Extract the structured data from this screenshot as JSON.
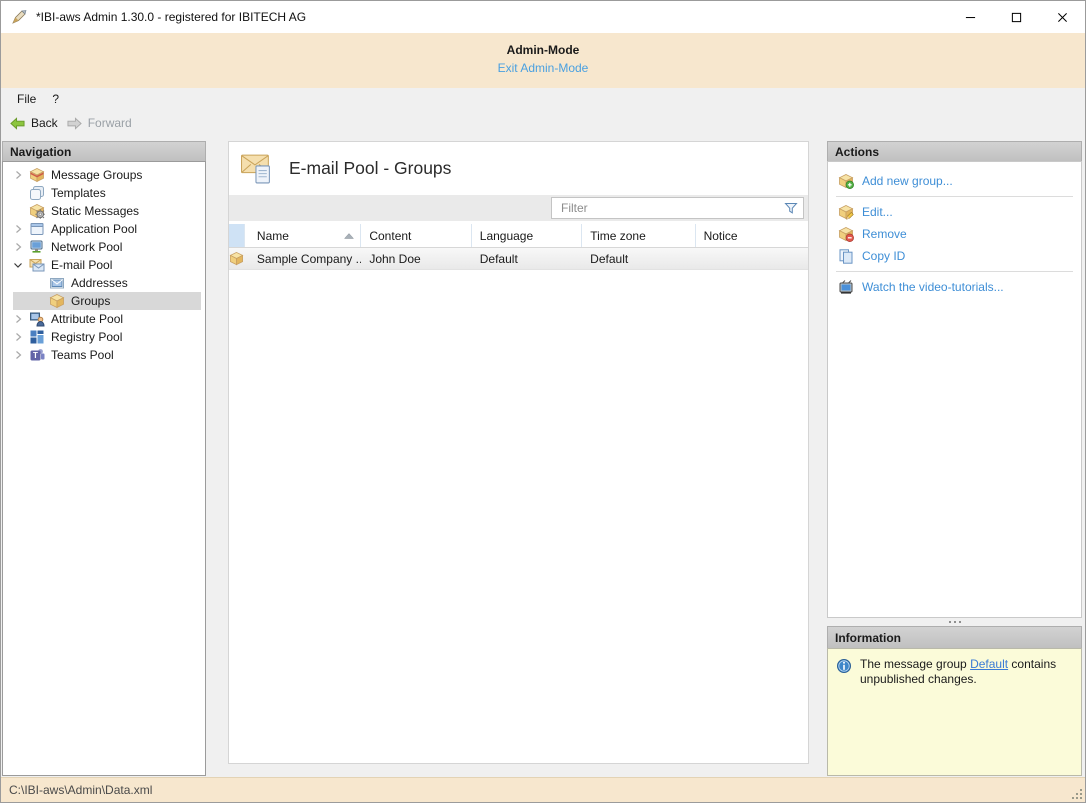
{
  "window": {
    "title": "*IBI-aws Admin 1.30.0 - registered for IBITECH AG"
  },
  "banner": {
    "title": "Admin-Mode",
    "exit_link": "Exit Admin-Mode"
  },
  "menu": {
    "items": [
      {
        "label": "File"
      },
      {
        "label": "?"
      }
    ]
  },
  "toolbar": {
    "back_label": "Back",
    "forward_label": "Forward",
    "forward_enabled": false
  },
  "navigation": {
    "header": "Navigation",
    "items": [
      {
        "label": "Message Groups",
        "icon": "message-groups-icon",
        "level": 0,
        "chevron": "collapsed",
        "selected": false
      },
      {
        "label": "Templates",
        "icon": "templates-icon",
        "level": 0,
        "chevron": "none",
        "selected": false
      },
      {
        "label": "Static Messages",
        "icon": "static-messages-icon",
        "level": 0,
        "chevron": "none",
        "selected": false
      },
      {
        "label": "Application Pool",
        "icon": "application-pool-icon",
        "level": 0,
        "chevron": "collapsed",
        "selected": false
      },
      {
        "label": "Network Pool",
        "icon": "network-pool-icon",
        "level": 0,
        "chevron": "collapsed",
        "selected": false
      },
      {
        "label": "E-mail Pool",
        "icon": "email-pool-icon",
        "level": 0,
        "chevron": "expanded",
        "selected": false
      },
      {
        "label": "Addresses",
        "icon": "addresses-icon",
        "level": 1,
        "chevron": "none",
        "selected": false
      },
      {
        "label": "Groups",
        "icon": "groups-icon",
        "level": 1,
        "chevron": "none",
        "selected": true
      },
      {
        "label": "Attribute Pool",
        "icon": "attribute-pool-icon",
        "level": 0,
        "chevron": "collapsed",
        "selected": false
      },
      {
        "label": "Registry Pool",
        "icon": "registry-pool-icon",
        "level": 0,
        "chevron": "collapsed",
        "selected": false
      },
      {
        "label": "Teams Pool",
        "icon": "teams-pool-icon",
        "level": 0,
        "chevron": "collapsed",
        "selected": false
      }
    ]
  },
  "main": {
    "title": "E-mail Pool - Groups",
    "icon": "email-groups-icon",
    "filter": {
      "placeholder": "Filter",
      "icon": "filter-funnel-icon"
    },
    "table": {
      "columns": [
        "Name",
        "Content",
        "Language",
        "Time zone",
        "Notice"
      ],
      "sorted_by": "Name",
      "sort_direction": "asc",
      "rows": [
        {
          "icon": "groups-icon",
          "cells": [
            "Sample Company ...",
            "John Doe",
            "Default",
            "Default",
            ""
          ]
        }
      ]
    }
  },
  "actions": {
    "header": "Actions",
    "items": [
      {
        "label": "Add new group...",
        "icon": "add-group-icon",
        "separator_after": true
      },
      {
        "label": "Edit...",
        "icon": "edit-group-icon",
        "separator_after": false
      },
      {
        "label": "Remove",
        "icon": "remove-group-icon",
        "separator_after": false
      },
      {
        "label": "Copy ID",
        "icon": "copy-id-icon",
        "separator_after": true
      },
      {
        "label": "Watch the video-tutorials...",
        "icon": "video-tutorials-icon",
        "separator_after": false
      }
    ]
  },
  "information": {
    "header": "Information",
    "icon": "info-icon",
    "message": {
      "text_before": "The message group ",
      "link_text": "Default",
      "text_after": " contains unpublished changes."
    }
  },
  "statusbar": {
    "path": "C:\\IBI-aws\\Admin\\Data.xml"
  },
  "colors": {
    "banner_bg": "#f7e7ce",
    "link_blue": "#3e8ed6",
    "panel_header_bg": "#c9c9c9",
    "info_bg": "#fbfbd9",
    "selection_bg": "#d8d8d8",
    "header_selector_bg": "#cfe2f5",
    "back_arrow_green": "#8dc63f"
  }
}
